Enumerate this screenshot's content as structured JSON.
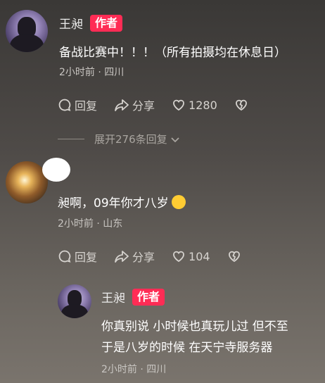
{
  "comment1": {
    "author": "王昶",
    "tag": "作者",
    "text": "备战比赛中！！！（所有拍摄均在休息日）",
    "meta": "2小时前 · 四川",
    "reply_label": "回复",
    "share_label": "分享",
    "like_count": "1280",
    "expand_label": "展开276条回复"
  },
  "comment2": {
    "text": "昶啊，09年你才八岁",
    "meta": "2小时前 · 山东",
    "reply_label": "回复",
    "share_label": "分享",
    "like_count": "104"
  },
  "reply1": {
    "author": "王昶",
    "tag": "作者",
    "text_line1": "你真别说 小时候也真玩儿过 但不至",
    "text_line2": "于是八岁的时候 在天宁寺服务器",
    "meta": "2小时前 · 四川"
  },
  "colors": {
    "tag_bg": "#ff2c55",
    "text_primary": "#ffffff",
    "text_secondary": "#c9c6c2"
  }
}
